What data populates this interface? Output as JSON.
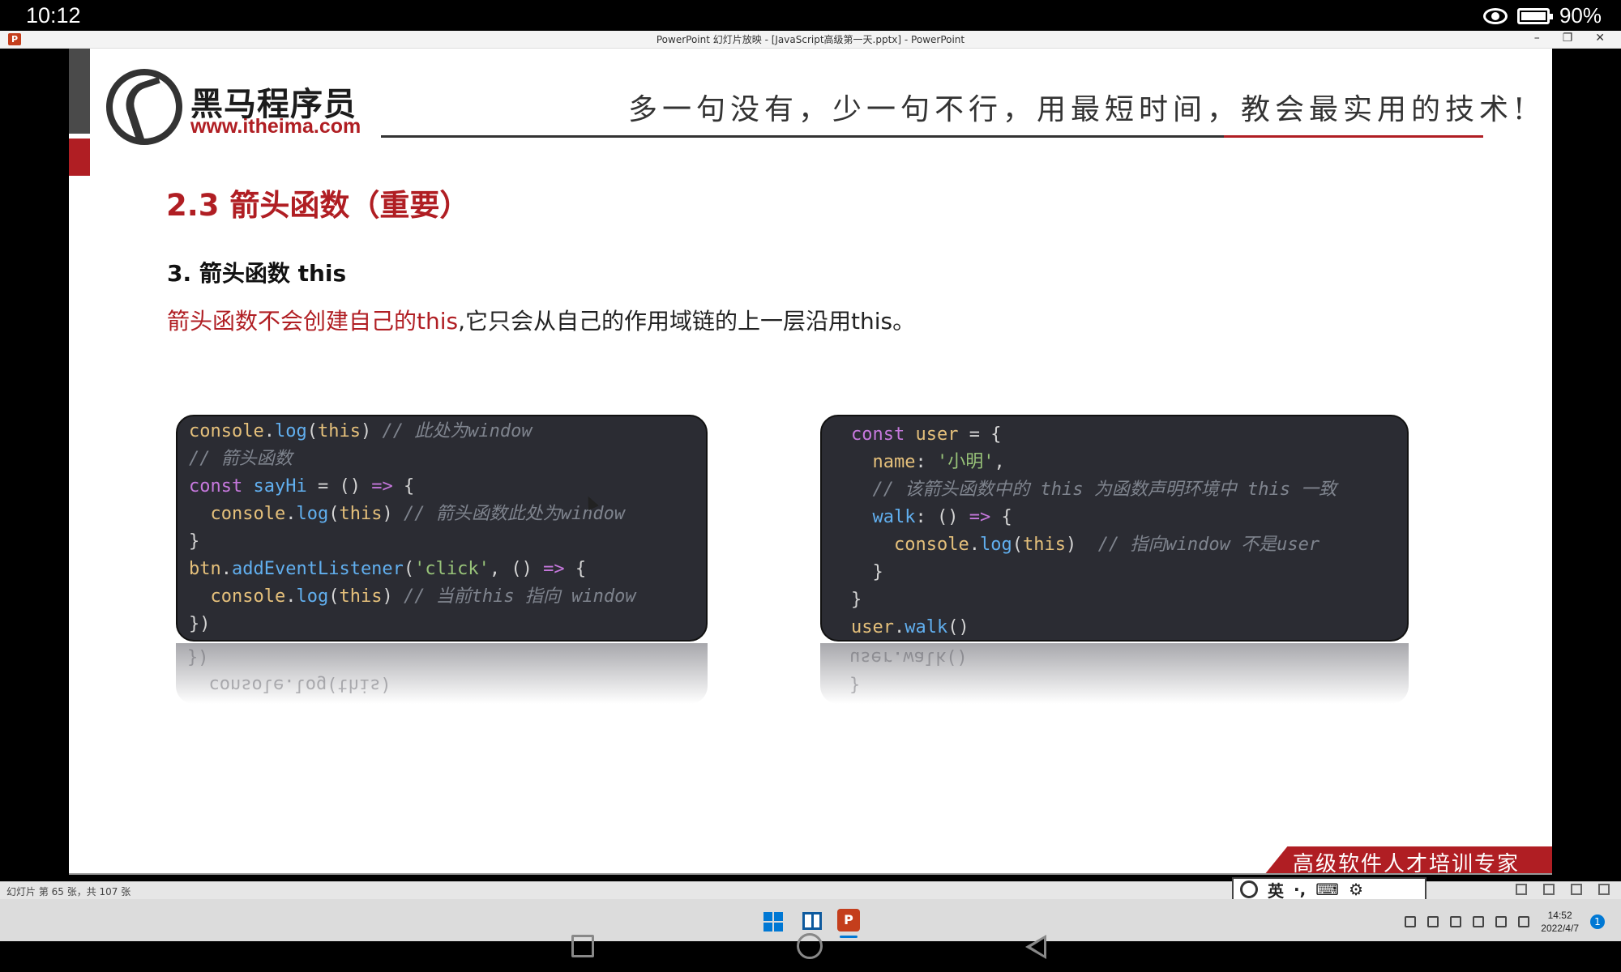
{
  "status_bar": {
    "time": "10:12",
    "battery": "90%"
  },
  "window": {
    "title": "PowerPoint 幻灯片放映 - [JavaScript高级第一天.pptx] - PowerPoint",
    "app_icon": "P",
    "controls": [
      "–",
      "❐",
      "✕"
    ]
  },
  "slide": {
    "logo_cn": "黑马程序员",
    "logo_url": "www.itheima.com",
    "slogan": "多一句没有，少一句不行，用最短时间，教会最实用的技术!",
    "section_title": "2.3 箭头函数（重要）",
    "subheading": "3. 箭头函数 this",
    "desc_red": "箭头函数不会创建自己的this",
    "desc_rest": ",它只会从自己的作用域链的上一层沿用this。",
    "banner": "高级软件人才培训专家",
    "code_left": {
      "l1_a": "console",
      "l1_b": ".",
      "l1_c": "log",
      "l1_d": "(",
      "l1_e": "this",
      "l1_f": ") ",
      "l1_cm": "// 此处为window",
      "l2_cm": "// 箭头函数",
      "l3_kw": "const",
      "l3_name": " sayHi",
      "l3_rest": " = () ",
      "l3_arrow": "=>",
      "l3_brace": " {",
      "l4_ind": "  ",
      "l4_a": "console",
      "l4_b": ".",
      "l4_c": "log",
      "l4_d": "(",
      "l4_e": "this",
      "l4_f": ") ",
      "l4_cm": "// 箭头函数此处为window",
      "l5": "}",
      "l6_a": "btn",
      "l6_b": ".",
      "l6_c": "addEventListener",
      "l6_d": "(",
      "l6_str": "'click'",
      "l6_e": ", () ",
      "l6_arrow": "=>",
      "l6_brace": " {",
      "l7_ind": "  ",
      "l7_a": "console",
      "l7_b": ".",
      "l7_c": "log",
      "l7_d": "(",
      "l7_e": "this",
      "l7_f": ") ",
      "l7_cm": "// 当前this 指向 window",
      "l8": "})",
      "refl_1": "})",
      "refl_2": "  console.log(this)"
    },
    "code_right": {
      "l1_kw": "const",
      "l1_name": " user",
      "l1_rest": " = {",
      "l2_ind": "  ",
      "l2_prop": "name",
      "l2_colon": ": ",
      "l2_str": "'小明'",
      "l2_comma": ",",
      "l3_ind": "  ",
      "l3_cm": "// 该箭头函数中的 this 为函数声明环境中 this 一致",
      "l4_ind": "  ",
      "l4_prop": "walk",
      "l4_rest": ": () ",
      "l4_arrow": "=>",
      "l4_brace": " {",
      "l5_ind": "    ",
      "l5_a": "console",
      "l5_b": ".",
      "l5_c": "log",
      "l5_d": "(",
      "l5_e": "this",
      "l5_f": ")  ",
      "l5_cm": "// 指向window 不是user",
      "l6": "  }",
      "l7": "}",
      "l8_a": "user",
      "l8_b": ".",
      "l8_c": "walk",
      "l8_d": "()",
      "refl_1": "user.walk()",
      "refl_2": "}"
    }
  },
  "ppt_status": {
    "slide_count": "幻灯片 第 65 张，共 107 张"
  },
  "ime": {
    "lang": "英",
    "items": [
      "·,",
      "⌨",
      "⚙"
    ]
  },
  "taskbar": {
    "ppt_icon": "P",
    "time": "14:52",
    "date": "2022/4/7",
    "notif": "1"
  }
}
